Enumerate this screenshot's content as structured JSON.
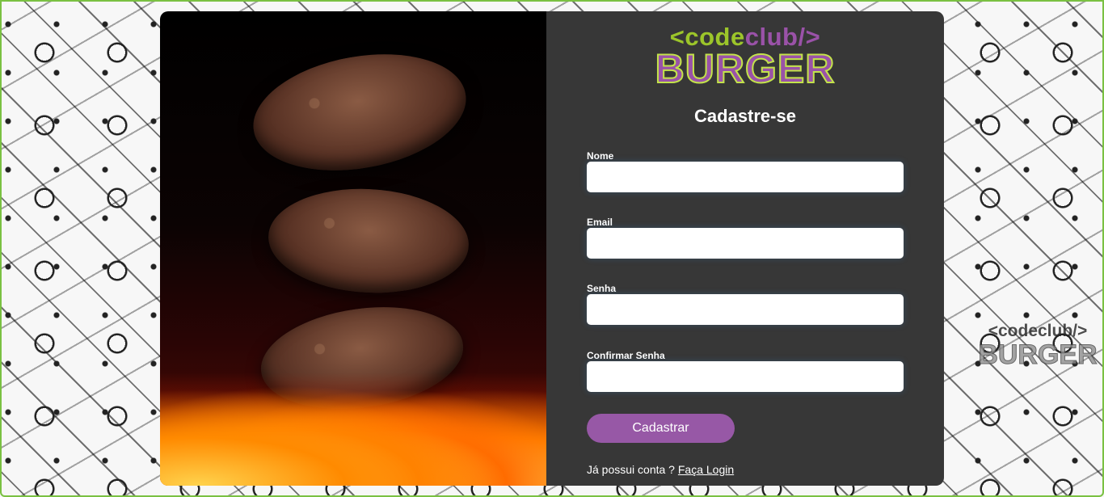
{
  "brand": {
    "logo_code": "<code",
    "logo_club": "club/>",
    "logo_burger": "BURGER"
  },
  "form": {
    "title": "Cadastre-se",
    "fields": [
      {
        "label": "Nome",
        "value": "",
        "placeholder": ""
      },
      {
        "label": "Email",
        "value": "",
        "placeholder": ""
      },
      {
        "label": "Senha",
        "value": "",
        "placeholder": ""
      },
      {
        "label": "Confirmar Senha",
        "value": "",
        "placeholder": ""
      }
    ],
    "submit_label": "Cadastrar",
    "login_prompt": "Já possui conta ?",
    "login_link": "Faça Login"
  },
  "colors": {
    "panel_bg": "#373737",
    "accent_purple": "#9758a6",
    "accent_green": "#9cc52a"
  }
}
